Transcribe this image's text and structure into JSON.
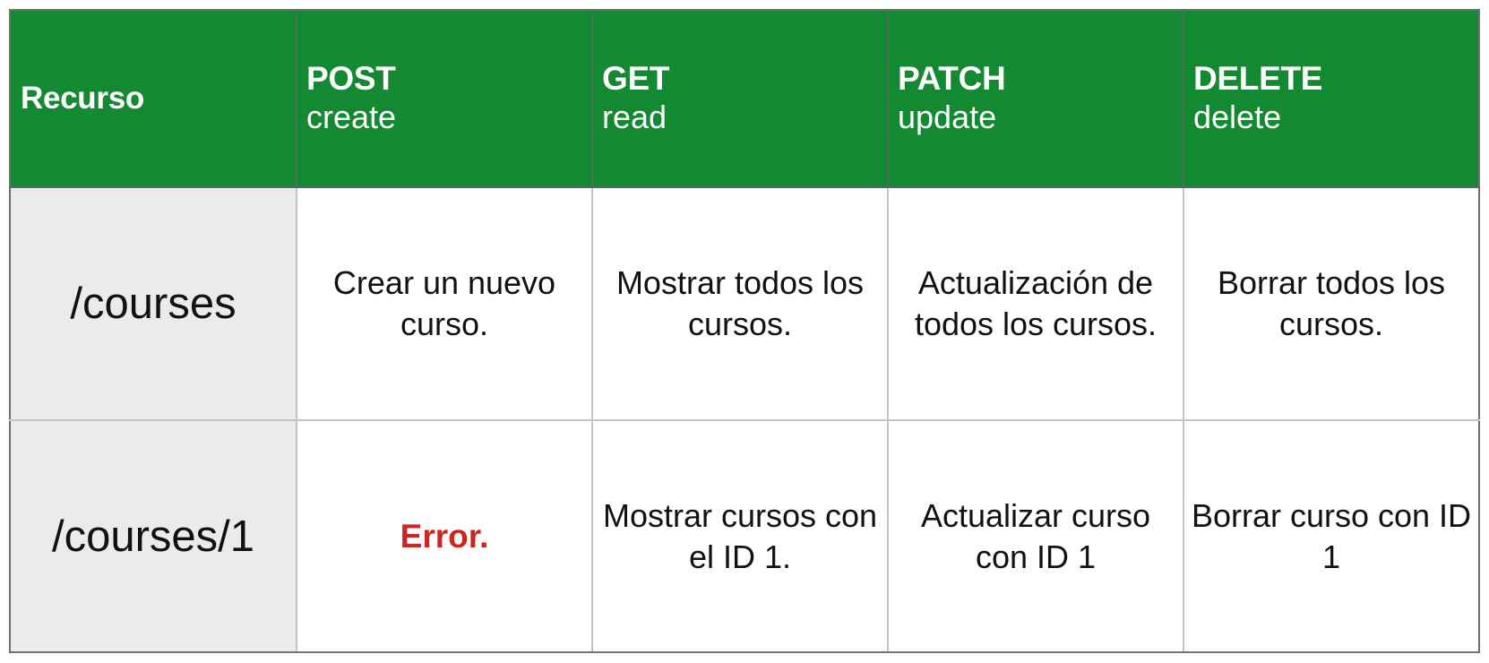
{
  "header": {
    "resource_label": "Recurso",
    "methods": [
      {
        "name": "POST",
        "action": "create"
      },
      {
        "name": "GET",
        "action": "read"
      },
      {
        "name": "PATCH",
        "action": "update"
      },
      {
        "name": "DELETE",
        "action": "delete"
      }
    ]
  },
  "rows": [
    {
      "resource": "/courses",
      "cells": [
        {
          "text": "Crear un nuevo curso."
        },
        {
          "text": "Mostrar todos los cursos."
        },
        {
          "text": "Actualización de todos los cursos."
        },
        {
          "text": "Borrar todos los cursos."
        }
      ]
    },
    {
      "resource": "/courses/1",
      "cells": [
        {
          "text": "Error."
        },
        {
          "text": "Mostrar cursos con el ID 1."
        },
        {
          "text": "Actualizar curso con ID 1"
        },
        {
          "text": "Borrar curso con ID 1"
        }
      ]
    }
  ],
  "colors": {
    "header_background": "#138932",
    "header_text": "#ffffff",
    "resource_background": "#ebebeb",
    "error_text": "#c9271f"
  }
}
